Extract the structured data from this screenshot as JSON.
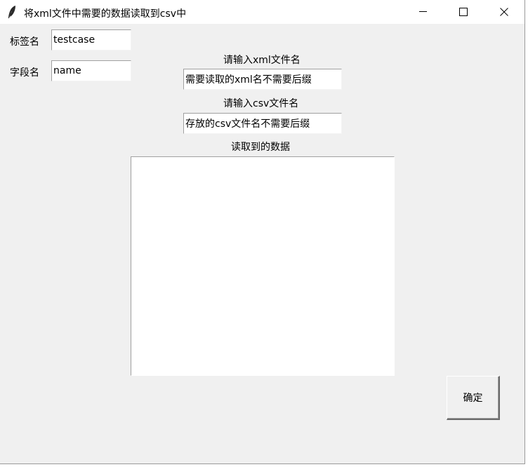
{
  "window": {
    "title": "将xml文件中需要的数据读取到csv中",
    "icons": {
      "app": "feather-icon",
      "minimize": "minimize-icon",
      "maximize": "maximize-icon",
      "close": "close-icon"
    }
  },
  "form": {
    "tag_label": "标签名",
    "tag_value": "testcase",
    "field_label": "字段名",
    "field_value": "name",
    "xml_label": "请输入xml文件名",
    "xml_value": "需要读取的xml名不需要后缀",
    "csv_label": "请输入csv文件名",
    "csv_value": "存放的csv文件名不需要后缀",
    "result_label": "读取到的数据",
    "result_value": "",
    "confirm_label": "确定"
  }
}
